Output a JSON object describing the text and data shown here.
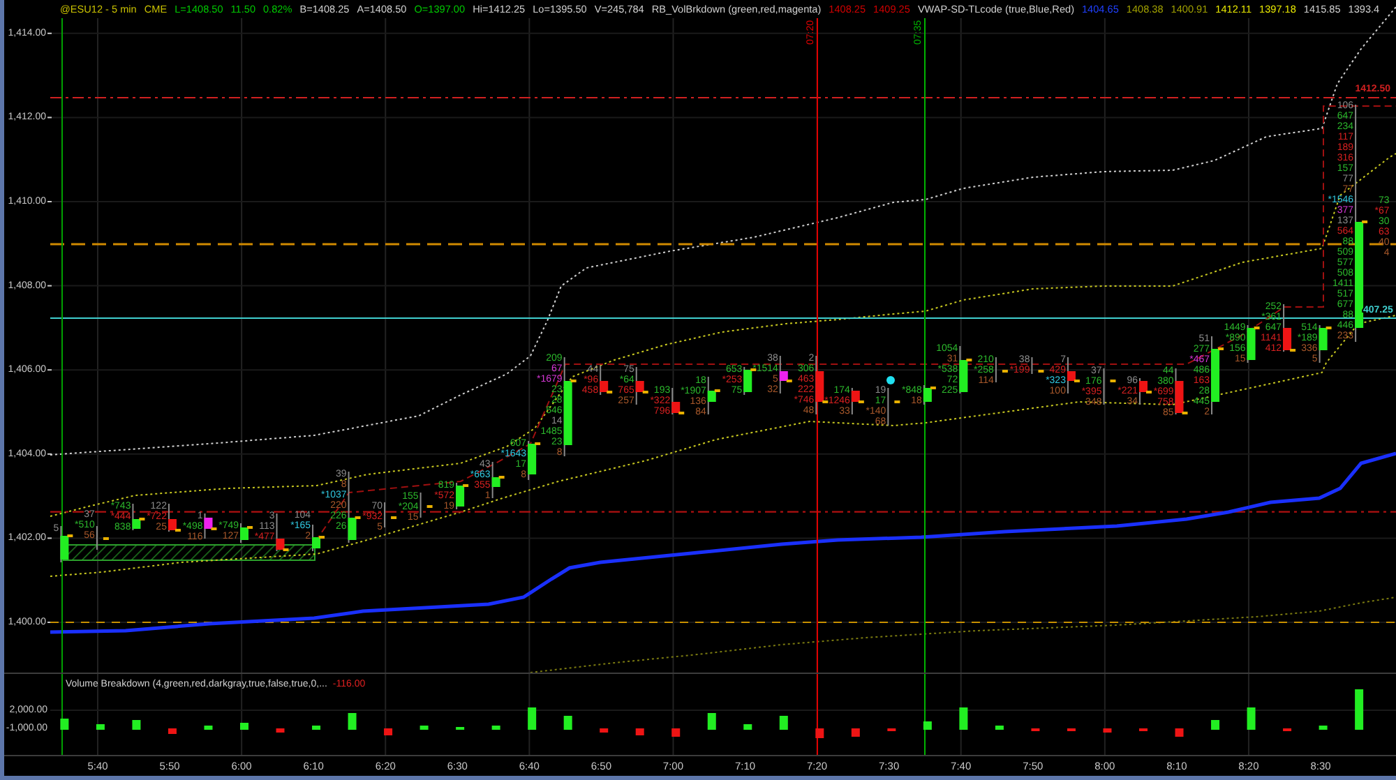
{
  "header": {
    "quote": [
      {
        "text": "@ESU12 - 5 min",
        "color": "#c8c000"
      },
      {
        "text": "CME",
        "color": "#c8c000"
      },
      {
        "text": "L=1408.50",
        "color": "#00c800"
      },
      {
        "text": "11.50",
        "color": "#00c800"
      },
      {
        "text": "0.82%",
        "color": "#00c800"
      },
      {
        "text": "B=1408.25",
        "color": "#d0d0d0"
      },
      {
        "text": "A=1408.50",
        "color": "#d0d0d0"
      },
      {
        "text": "O=1397.00",
        "color": "#00c800"
      },
      {
        "text": "Hi=1412.25",
        "color": "#d0d0d0"
      },
      {
        "text": "Lo=1395.50",
        "color": "#d0d0d0"
      },
      {
        "text": "V=245,784",
        "color": "#d0d0d0"
      }
    ],
    "indicators": [
      {
        "name": "RB_VolBrkdown (green,red,magenta)",
        "values": [
          {
            "text": "1408.25",
            "color": "#d00000"
          },
          {
            "text": "1409.25",
            "color": "#d00000"
          }
        ]
      },
      {
        "name": "VWAP-SD-TLcode (true,Blue,Red)",
        "values": [
          {
            "text": "1404.65",
            "color": "#2040ff"
          },
          {
            "text": "1408.38",
            "color": "#a0a000"
          },
          {
            "text": "1400.91",
            "color": "#a0a000"
          },
          {
            "text": "1412.11",
            "color": "#e8e800"
          },
          {
            "text": "1397.18",
            "color": "#e8e800"
          },
          {
            "text": "1415.85",
            "color": "#d0d0d0"
          },
          {
            "text": "1393.4",
            "color": "#d0d0d0"
          }
        ]
      }
    ]
  },
  "markers": [
    {
      "label": "07:20",
      "color": "#e00000"
    },
    {
      "label": "07:35",
      "color": "#00b400"
    }
  ],
  "levels": [
    {
      "label": "1412.50",
      "color": "#d02020"
    },
    {
      "label": "407.25",
      "color": "#40d0d0"
    }
  ],
  "price_axis": [
    "1,414.00",
    "1,412.00",
    "1,410.00",
    "1,408.00",
    "1,406.00",
    "1,404.00",
    "1,402.00",
    "1,400.00"
  ],
  "bars": [
    {
      "labels": [
        {
          "text": "5",
          "color": "#8c8c8c"
        }
      ]
    },
    {
      "labels": [
        {
          "text": "37",
          "color": "#8c8c8c"
        },
        {
          "text": "*510",
          "color": "#2cb82c"
        },
        {
          "text": "56",
          "color": "#a8582a"
        }
      ]
    },
    {
      "labels": [
        {
          "text": "*743",
          "color": "#2cb82c"
        },
        {
          "text": "*444",
          "color": "#d82020"
        },
        {
          "text": "838",
          "color": "#2cb82c"
        }
      ]
    },
    {
      "labels": [
        {
          "text": "122",
          "color": "#8c8c8c"
        },
        {
          "text": "*722",
          "color": "#d82020"
        },
        {
          "text": "25",
          "color": "#a8582a"
        }
      ]
    },
    {
      "labels": [
        {
          "text": "1",
          "color": "#8c8c8c"
        },
        {
          "text": "*498",
          "color": "#2cb82c"
        },
        {
          "text": "116",
          "color": "#a8582a"
        }
      ]
    },
    {
      "labels": [
        {
          "text": "*749",
          "color": "#2cb82c"
        },
        {
          "text": "127",
          "color": "#a8582a"
        }
      ]
    },
    {
      "labels": [
        {
          "text": "3",
          "color": "#8c8c8c"
        },
        {
          "text": "113",
          "color": "#8c8c8c"
        },
        {
          "text": "*477",
          "color": "#d82020"
        }
      ]
    },
    {
      "labels": [
        {
          "text": "104",
          "color": "#8c8c8c"
        },
        {
          "text": "*165",
          "color": "#30c8e0"
        },
        {
          "text": "2",
          "color": "#a8582a"
        }
      ]
    },
    {
      "labels": [
        {
          "text": "39",
          "color": "#8c8c8c"
        },
        {
          "text": "8",
          "color": "#a8582a"
        },
        {
          "text": "*1037",
          "color": "#30c8e0"
        },
        {
          "text": "220",
          "color": "#a8582a"
        },
        {
          "text": "226",
          "color": "#2cb82c"
        },
        {
          "text": "26",
          "color": "#2cb82c"
        }
      ]
    },
    {
      "labels": [
        {
          "text": "70",
          "color": "#8c8c8c"
        },
        {
          "text": "*932",
          "color": "#d82020"
        },
        {
          "text": "5",
          "color": "#a8582a"
        }
      ]
    },
    {
      "labels": [
        {
          "text": "155",
          "color": "#2cb82c"
        },
        {
          "text": "*204",
          "color": "#2cb82c"
        },
        {
          "text": "15",
          "color": "#a8582a"
        }
      ]
    },
    {
      "labels": [
        {
          "text": "819",
          "color": "#2cb82c"
        },
        {
          "text": "*572",
          "color": "#d82020"
        },
        {
          "text": "19",
          "color": "#a8582a"
        }
      ]
    },
    {
      "labels": [
        {
          "text": "43",
          "color": "#8c8c8c"
        },
        {
          "text": "*663",
          "color": "#30c8e0"
        },
        {
          "text": "355",
          "color": "#d82020"
        },
        {
          "text": "1",
          "color": "#a8582a"
        }
      ]
    },
    {
      "labels": [
        {
          "text": "607",
          "color": "#2cb82c"
        },
        {
          "text": "*1643",
          "color": "#30c8e0"
        },
        {
          "text": "17",
          "color": "#2cb82c"
        },
        {
          "text": "8",
          "color": "#a8582a"
        }
      ]
    },
    {
      "labels": [
        {
          "text": "209",
          "color": "#2cb82c"
        },
        {
          "text": "67",
          "color": "#d838d8"
        },
        {
          "text": "*1679",
          "color": "#d838d8"
        },
        {
          "text": "23",
          "color": "#2cb82c"
        },
        {
          "text": "28",
          "color": "#2cb82c"
        },
        {
          "text": "546",
          "color": "#2cb82c"
        },
        {
          "text": "14",
          "color": "#8c8c8c"
        },
        {
          "text": "1485",
          "color": "#2cb82c"
        },
        {
          "text": "23",
          "color": "#2cb82c"
        },
        {
          "text": "8",
          "color": "#a8582a"
        }
      ]
    },
    {
      "labels": [
        {
          "text": "44",
          "color": "#8c8c8c"
        },
        {
          "text": "*96",
          "color": "#d82020"
        },
        {
          "text": "458",
          "color": "#d82020"
        }
      ]
    },
    {
      "labels": [
        {
          "text": "75",
          "color": "#8c8c8c"
        },
        {
          "text": "*64",
          "color": "#2cb82c"
        },
        {
          "text": "765",
          "color": "#d82020"
        },
        {
          "text": "257",
          "color": "#a8582a"
        }
      ]
    },
    {
      "labels": [
        {
          "text": "193",
          "color": "#2cb82c"
        },
        {
          "text": "*322",
          "color": "#d82020"
        },
        {
          "text": "796",
          "color": "#d82020"
        }
      ]
    },
    {
      "labels": [
        {
          "text": "18",
          "color": "#2cb82c"
        },
        {
          "text": "*1907",
          "color": "#2cb82c"
        },
        {
          "text": "136",
          "color": "#a8582a"
        },
        {
          "text": "84",
          "color": "#a8582a"
        }
      ]
    },
    {
      "labels": [
        {
          "text": "653",
          "color": "#2cb82c"
        },
        {
          "text": "*253",
          "color": "#d82020"
        },
        {
          "text": "75",
          "color": "#2cb82c"
        }
      ]
    },
    {
      "labels": [
        {
          "text": "38",
          "color": "#8c8c8c"
        },
        {
          "text": "*1514",
          "color": "#2cb82c"
        },
        {
          "text": "5",
          "color": "#a8582a"
        },
        {
          "text": "32",
          "color": "#a8582a"
        }
      ]
    },
    {
      "labels": [
        {
          "text": "2",
          "color": "#8c8c8c"
        },
        {
          "text": "306",
          "color": "#2cb82c"
        },
        {
          "text": "463",
          "color": "#d82020"
        },
        {
          "text": "222",
          "color": "#d82020"
        },
        {
          "text": "*746",
          "color": "#d82020"
        },
        {
          "text": "48",
          "color": "#a8582a"
        }
      ]
    },
    {
      "labels": [
        {
          "text": "174",
          "color": "#2cb82c"
        },
        {
          "text": "*1246",
          "color": "#d82020"
        },
        {
          "text": "33",
          "color": "#a8582a"
        }
      ]
    },
    {
      "labels": [
        {
          "text": "19",
          "color": "#8c8c8c"
        },
        {
          "text": "17",
          "color": "#2cb82c"
        },
        {
          "text": "*140",
          "color": "#a8582a"
        },
        {
          "text": "68",
          "color": "#a8582a"
        }
      ]
    },
    {
      "labels": [
        {
          "text": "*848",
          "color": "#2cb82c"
        },
        {
          "text": "18",
          "color": "#a8582a"
        }
      ]
    },
    {
      "labels": [
        {
          "text": "1054",
          "color": "#2cb82c"
        },
        {
          "text": "31",
          "color": "#a8582a"
        },
        {
          "text": "*538",
          "color": "#2cb82c"
        },
        {
          "text": "72",
          "color": "#2cb82c"
        },
        {
          "text": "225",
          "color": "#2cb82c"
        }
      ]
    },
    {
      "labels": [
        {
          "text": "210",
          "color": "#2cb82c"
        },
        {
          "text": "*258",
          "color": "#2cb82c"
        },
        {
          "text": "114",
          "color": "#a8582a"
        }
      ]
    },
    {
      "labels": [
        {
          "text": "38",
          "color": "#8c8c8c"
        },
        {
          "text": "*199",
          "color": "#d82020"
        }
      ]
    },
    {
      "labels": [
        {
          "text": "7",
          "color": "#8c8c8c"
        },
        {
          "text": "429",
          "color": "#d82020"
        },
        {
          "text": "*323",
          "color": "#30c8e0"
        },
        {
          "text": "100",
          "color": "#a8582a"
        }
      ]
    },
    {
      "labels": [
        {
          "text": "37",
          "color": "#8c8c8c"
        },
        {
          "text": "176",
          "color": "#2cb82c"
        },
        {
          "text": "*395",
          "color": "#d82020"
        },
        {
          "text": "348",
          "color": "#a8582a"
        }
      ]
    },
    {
      "labels": [
        {
          "text": "96",
          "color": "#8c8c8c"
        },
        {
          "text": "*221",
          "color": "#d82020"
        },
        {
          "text": "34",
          "color": "#a8582a"
        }
      ]
    },
    {
      "labels": [
        {
          "text": "44",
          "color": "#2cb82c"
        },
        {
          "text": "380",
          "color": "#2cb82c"
        },
        {
          "text": "*699",
          "color": "#d82020"
        },
        {
          "text": "758",
          "color": "#d82020"
        },
        {
          "text": "85",
          "color": "#a8582a"
        }
      ]
    },
    {
      "labels": [
        {
          "text": "51",
          "color": "#8c8c8c"
        },
        {
          "text": "277",
          "color": "#2cb82c"
        },
        {
          "text": "*467",
          "color": "#d838d8"
        },
        {
          "text": "486",
          "color": "#2cb82c"
        },
        {
          "text": "163",
          "color": "#d82020"
        },
        {
          "text": "28",
          "color": "#2cb82c"
        },
        {
          "text": "445",
          "color": "#2cb82c"
        },
        {
          "text": "2",
          "color": "#a8582a"
        }
      ]
    },
    {
      "labels": [
        {
          "text": "1449",
          "color": "#2cb82c"
        },
        {
          "text": "*890",
          "color": "#2cb82c"
        },
        {
          "text": "156",
          "color": "#2cb82c"
        },
        {
          "text": "15",
          "color": "#a8582a"
        }
      ]
    },
    {
      "labels": [
        {
          "text": "252",
          "color": "#2cb82c"
        },
        {
          "text": "*361",
          "color": "#2cb82c"
        },
        {
          "text": "647",
          "color": "#2cb82c"
        },
        {
          "text": "1141",
          "color": "#d82020"
        },
        {
          "text": "412",
          "color": "#d82020"
        }
      ]
    },
    {
      "labels": [
        {
          "text": "514",
          "color": "#2cb82c"
        },
        {
          "text": "*189",
          "color": "#2cb82c"
        },
        {
          "text": "336",
          "color": "#a8582a"
        },
        {
          "text": "5",
          "color": "#a8582a"
        }
      ]
    },
    {
      "labels": [
        {
          "text": "106",
          "color": "#8c8c8c"
        },
        {
          "text": "647",
          "color": "#2cb82c"
        },
        {
          "text": "234",
          "color": "#2cb82c"
        },
        {
          "text": "117",
          "color": "#d82020"
        },
        {
          "text": "189",
          "color": "#d82020"
        },
        {
          "text": "316",
          "color": "#d82020"
        },
        {
          "text": "157",
          "color": "#2cb82c"
        },
        {
          "text": "77",
          "color": "#8c8c8c"
        },
        {
          "text": "77",
          "color": "#a8582a"
        },
        {
          "text": "*1546",
          "color": "#30c8e0"
        },
        {
          "text": "377",
          "color": "#d838d8"
        },
        {
          "text": "137",
          "color": "#8c8c8c"
        },
        {
          "text": "564",
          "color": "#d82020"
        },
        {
          "text": "88",
          "color": "#2cb82c"
        },
        {
          "text": "509",
          "color": "#2cb82c"
        },
        {
          "text": "577",
          "color": "#2cb82c"
        },
        {
          "text": "508",
          "color": "#2cb82c"
        },
        {
          "text": "1411",
          "color": "#2cb82c"
        },
        {
          "text": "517",
          "color": "#2cb82c"
        },
        {
          "text": "677",
          "color": "#2cb82c"
        },
        {
          "text": "88",
          "color": "#2cb82c"
        },
        {
          "text": "446",
          "color": "#2cb82c"
        },
        {
          "text": "233",
          "color": "#a8582a"
        }
      ]
    },
    {
      "labels": [
        {
          "text": "73",
          "color": "#2cb82c"
        },
        {
          "text": "*67",
          "color": "#d82020"
        },
        {
          "text": "30",
          "color": "#2cb82c"
        },
        {
          "text": "63",
          "color": "#d82020"
        },
        {
          "text": "40",
          "color": "#a8582a"
        },
        {
          "text": "4",
          "color": "#a8582a"
        }
      ]
    }
  ],
  "volume_pane": {
    "title": "Volume Breakdown (4,green,red,darkgray,true,false,true,0,...",
    "value": "-116.00",
    "axis": [
      "2,000.00",
      "-1,000.00"
    ]
  },
  "time_axis": [
    "5:40",
    "5:50",
    "6:00",
    "6:10",
    "6:20",
    "6:30",
    "6:40",
    "6:50",
    "7:00",
    "7:10",
    "7:20",
    "7:30",
    "7:40",
    "7:50",
    "8:00",
    "8:10",
    "8:20",
    "8:30"
  ]
}
